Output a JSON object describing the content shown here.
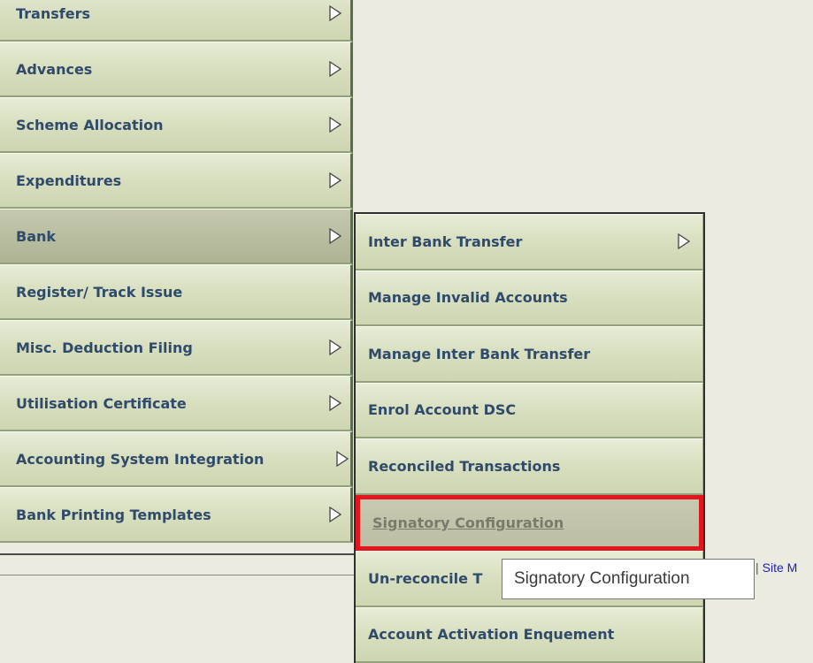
{
  "main_menu": {
    "items": [
      {
        "label": "Transfers",
        "has_arrow": true
      },
      {
        "label": "Advances",
        "has_arrow": true
      },
      {
        "label": "Scheme Allocation",
        "has_arrow": true
      },
      {
        "label": "Expenditures",
        "has_arrow": true
      },
      {
        "label": "Bank",
        "has_arrow": true,
        "active": true
      },
      {
        "label": "Register/ Track Issue",
        "has_arrow": false
      },
      {
        "label": "Misc. Deduction Filing",
        "has_arrow": true
      },
      {
        "label": "Utilisation Certificate",
        "has_arrow": true
      },
      {
        "label": "Accounting System Integration",
        "has_arrow": true
      },
      {
        "label": "Bank Printing Templates",
        "has_arrow": true
      }
    ]
  },
  "sub_menu": {
    "items": [
      {
        "label": "Inter Bank Transfer",
        "has_arrow": true
      },
      {
        "label": "Manage Invalid Accounts",
        "has_arrow": false
      },
      {
        "label": "Manage Inter Bank Transfer",
        "has_arrow": false
      },
      {
        "label": "Enrol Account DSC",
        "has_arrow": false
      },
      {
        "label": "Reconciled Transactions",
        "has_arrow": false
      },
      {
        "label": "Signatory Configuration",
        "has_arrow": false,
        "selected": true
      },
      {
        "label": "Un-reconcile T",
        "has_arrow": false
      },
      {
        "label": "Account Activation Enquement",
        "has_arrow": false
      }
    ]
  },
  "tooltip": {
    "text": "Signatory Configuration"
  },
  "footer": {
    "separator": "|",
    "site_link": "Site M"
  },
  "colors": {
    "menu_text": "#2f4a6a",
    "selected_border": "#e2161c",
    "link": "#1c1cc4"
  },
  "icons": {
    "submenu_arrow": "chevron-right-outline-icon"
  }
}
